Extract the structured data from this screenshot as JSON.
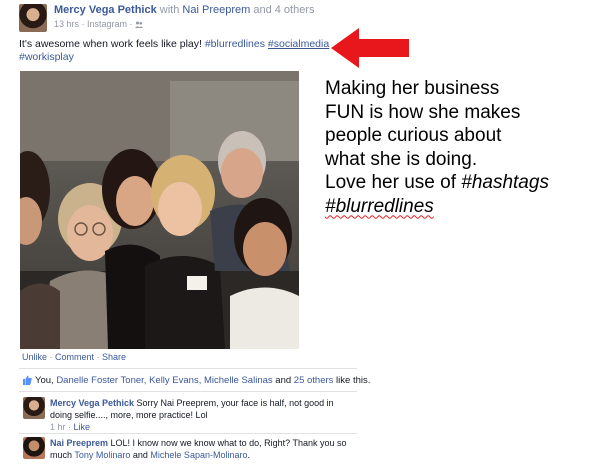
{
  "post": {
    "author": "Mercy Vega Pethick",
    "with_prefix": " with ",
    "tagged": "Nai Preeprem",
    "and_others": " and 4 others",
    "time": "13 hrs · Instagram · ",
    "status_text": "It's awesome when work feels like play!",
    "hashtags": [
      "#blurredlines",
      "#socialmedia",
      "#workisplay"
    ],
    "actions": [
      "Unlike",
      "Comment",
      "Share"
    ],
    "likes": {
      "you": "You, ",
      "names": "Danelle Foster Toner, Kelly Evans, Michelle Salinas",
      "and": " and ",
      "others": "25 others",
      "suffix": " like this."
    }
  },
  "comments": [
    {
      "author": "Mercy Vega Pethick",
      "text": " Sorry Nai Preeprem, your face is half, not good in doing selfie...., more, more practice! Lol",
      "time": "1 hr",
      "like": "Like"
    },
    {
      "author": "Nai Preeprem",
      "text": " LOL! I know now we know what to do, Right? Thank you so much ",
      "mention1": "Tony Molinaro",
      "and": " and ",
      "mention2": "Michele Sapan-Molinaro",
      "end": "."
    }
  ],
  "annotation": {
    "lines": [
      "Making her business",
      "FUN is how she makes",
      "people curious about",
      "what she is doing."
    ],
    "love_prefix": "Love her use of ",
    "love_hashtag": "#hashtags",
    "last_hashtag": "#blurredlines",
    "arrow_color": "#e8171b"
  },
  "icons": {
    "thumb": "thumbs-up-icon",
    "audience": "friends-icon",
    "arrow": "red-arrow-left-icon"
  }
}
